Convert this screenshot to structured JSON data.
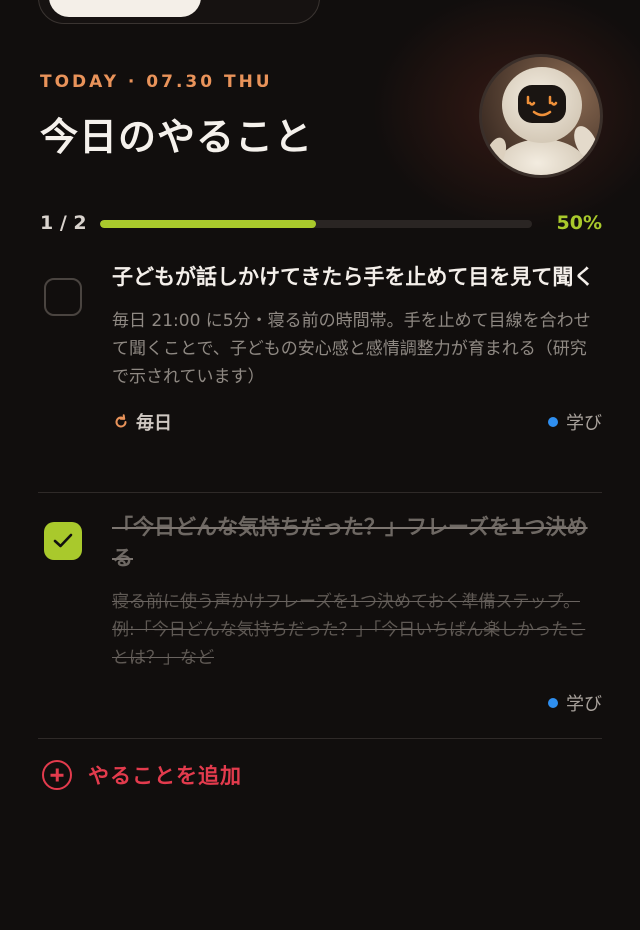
{
  "header": {
    "date_line": "TODAY · 07.30 THU",
    "title": "今日のやること"
  },
  "progress": {
    "count_label": "1 / 2",
    "percent_label": "50%",
    "fraction": 0.5
  },
  "tasks": [
    {
      "title": "子どもが話しかけてきたら手を止めて目を見て聞く",
      "description": "毎日 21:00 に5分・寝る前の時間帯。手を止めて目線を合わせて聞くことで、子どもの安心感と感情調整力が育まれる（研究で示されています）",
      "repeat_label": "毎日",
      "category": "学び",
      "completed": false
    },
    {
      "title": "「今日どんな気持ちだった？」フレーズを1つ決める",
      "description": "寝る前に使う声かけフレーズを1つ決めておく準備ステップ。例:「今日どんな気持ちだった？」「今日いちばん楽しかったことは？」など",
      "category": "学び",
      "completed": true
    }
  ],
  "add_task": {
    "label": "やることを追加"
  },
  "colors": {
    "accent_orange": "#e9935a",
    "progress_green": "#a9c92c",
    "add_red": "#e33b4d",
    "category_blue": "#2f8ff0",
    "background": "#110e0d"
  },
  "icons": {
    "repeat": "repeat-icon",
    "check": "check-icon",
    "add": "plus-circle-icon"
  }
}
